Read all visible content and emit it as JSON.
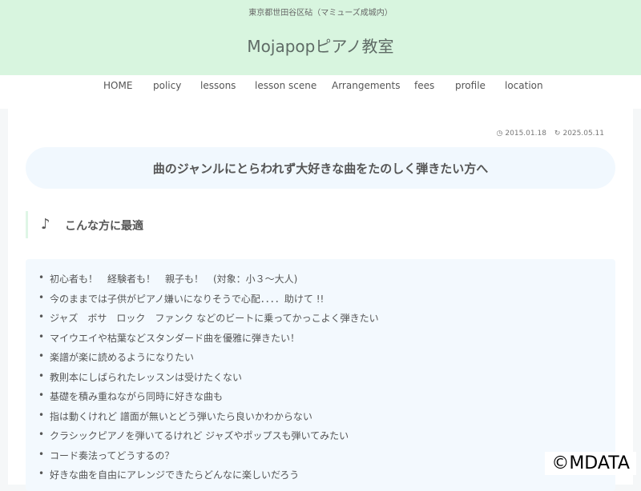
{
  "header": {
    "tagline": "東京都世田谷区砧（マミューズ成城内）",
    "site_title": "Mojapopピアノ教室"
  },
  "nav": {
    "items": [
      {
        "label": "HOME"
      },
      {
        "label": "policy"
      },
      {
        "label": "lessons"
      },
      {
        "label": "lesson scene"
      },
      {
        "label": "Arrangements"
      },
      {
        "label": "fees"
      },
      {
        "label": "profile"
      },
      {
        "label": "location"
      }
    ]
  },
  "post": {
    "published": "2015.01.18",
    "updated": "2025.05.11",
    "title": "曲のジャンルにとらわれず大好きな曲をたのしく弾きたい方へ"
  },
  "section": {
    "title": "こんな方に最適"
  },
  "list": [
    "初心者も！　経験者も！　親子も！　(対象：小３～大人)",
    "今のままでは子供がピアノ嫌いになりそうで心配．．．．助けて !!",
    "ジャズ　ボサ　ロック　ファンク などのビートに乗ってかっこよく弾きたい",
    "マイウエイや枯葉などスタンダード曲を優雅に弾きたい！",
    "楽譜が楽に読めるようになりたい",
    "教則本にしばられたレッスンは受けたくない",
    "基礎を積み重ねながら同時に好きな曲も",
    "指は動くけれど 譜面が無いとどう弾いたら良いかわからない",
    "クラシックピアノを弾いてるけれど ジャズやポップスも弾いてみたい",
    "コード奏法ってどうするの？",
    "好きな曲を自由にアレンジできたらどんなに楽しいだろう"
  ],
  "watermark": "©MDATA"
}
